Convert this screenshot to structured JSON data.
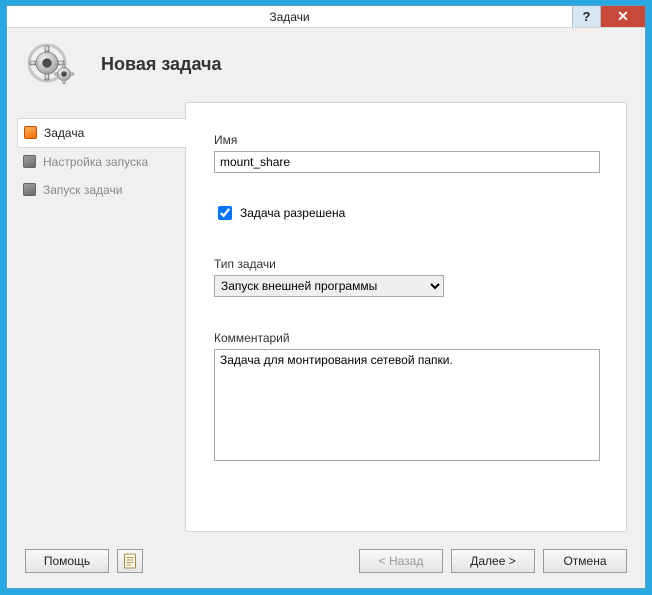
{
  "window": {
    "title": "Задачи",
    "help_symbol": "?",
    "close_symbol": "✕"
  },
  "header": {
    "title": "Новая задача"
  },
  "sidebar": {
    "items": [
      {
        "label": "Задача",
        "active": true
      },
      {
        "label": "Настройка запуска",
        "active": false
      },
      {
        "label": "Запуск задачи",
        "active": false
      }
    ]
  },
  "form": {
    "name_label": "Имя",
    "name_value": "mount_share",
    "enabled_label": "Задача разрешена",
    "enabled_checked": true,
    "type_label": "Тип задачи",
    "type_value": "Запуск внешней программы",
    "comment_label": "Комментарий",
    "comment_value": "Задача для монтирования сетевой папки."
  },
  "footer": {
    "help": "Помощь",
    "back": "< Назад",
    "next": "Далее >",
    "cancel": "Отмена"
  }
}
